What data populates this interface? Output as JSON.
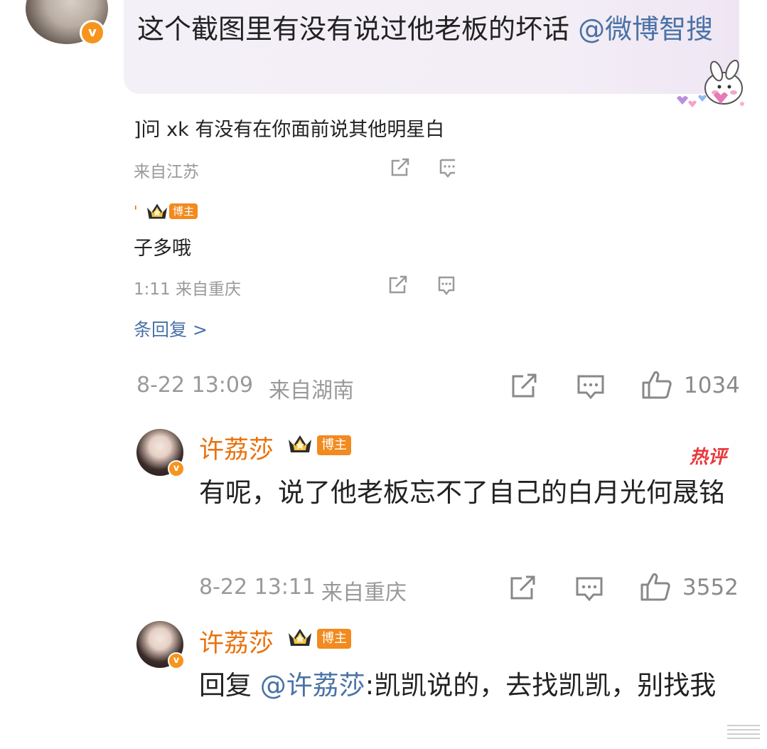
{
  "top_comment": {
    "text": "这个截图里有没有说过他老板的坏话 ",
    "mention": "@微博智搜",
    "avatar_badge": "v"
  },
  "quoted": {
    "line1": "]问 xk 有没有在你面前说其他明星白",
    "meta1": "来自江苏",
    "tag": "博主",
    "line2": "子多哦",
    "meta2": "1:11  来自重庆",
    "more_replies": "条回复 >"
  },
  "comment1_meta": {
    "time": "8-22 13:09",
    "location": "来自湖南",
    "likes": "1034"
  },
  "reply1": {
    "username": "许荔莎",
    "tag": "博主",
    "text": "有呢，说了他老板忘不了自己的白月光何晟铭",
    "time": "8-22 13:11",
    "location": "来自重庆",
    "likes": "3552",
    "hot_label": "热评",
    "avatar_badge": "v"
  },
  "reply2": {
    "username": "许荔莎",
    "tag": "博主",
    "reply_prefix": "回复 ",
    "mention": "@许荔莎",
    "text": ":凯凯说的，去找凯凯，别找我",
    "avatar_badge": "v"
  },
  "icons": {
    "share": "share-icon",
    "comment": "comment-icon",
    "like": "thumbs-up-icon",
    "crown": "crown-icon"
  },
  "colors": {
    "username": "#e8720c",
    "mention": "#4a72a6",
    "meta": "#999999",
    "tag": "#f18a1f"
  }
}
